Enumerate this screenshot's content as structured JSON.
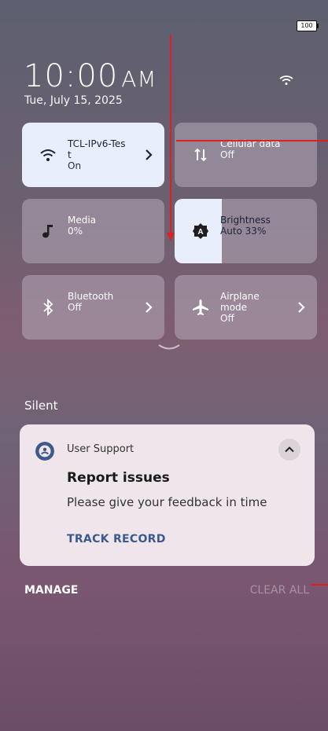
{
  "status_bar": {
    "battery": "100"
  },
  "header": {
    "time": "10:00",
    "ampm": "AM",
    "date": "Tue, July 15, 2025"
  },
  "tiles": {
    "wifi": {
      "name_line1": "TCL-IPv6-Tes",
      "name_line2": "t",
      "state": "On",
      "icon": "wifi-icon"
    },
    "cellular": {
      "name": "Cellular data",
      "state": "Off",
      "icon": "cellular-data-icon"
    },
    "media": {
      "name": "Media",
      "state": "0%",
      "icon": "music-note-icon"
    },
    "brightness": {
      "name": "Brightness",
      "state": "Auto 33%",
      "level": 0.33,
      "icon": "brightness-auto-icon"
    },
    "bluetooth": {
      "name": "Bluetooth",
      "state": "Off",
      "icon": "bluetooth-icon"
    },
    "airplane": {
      "name_line1": "Airplane",
      "name_line2": "mode",
      "state": "Off",
      "icon": "airplane-icon"
    }
  },
  "section": {
    "label": "Silent"
  },
  "notification": {
    "app_name": "User Support",
    "title": "Report issues",
    "body": "Please give your feedback in time",
    "action": "TRACK RECORD"
  },
  "footer": {
    "manage": "MANAGE",
    "clear_all": "CLEAR ALL"
  },
  "colors": {
    "active_tile": "#e9eefc",
    "annotation": "#e02020",
    "action_text": "#3a5a8f"
  }
}
